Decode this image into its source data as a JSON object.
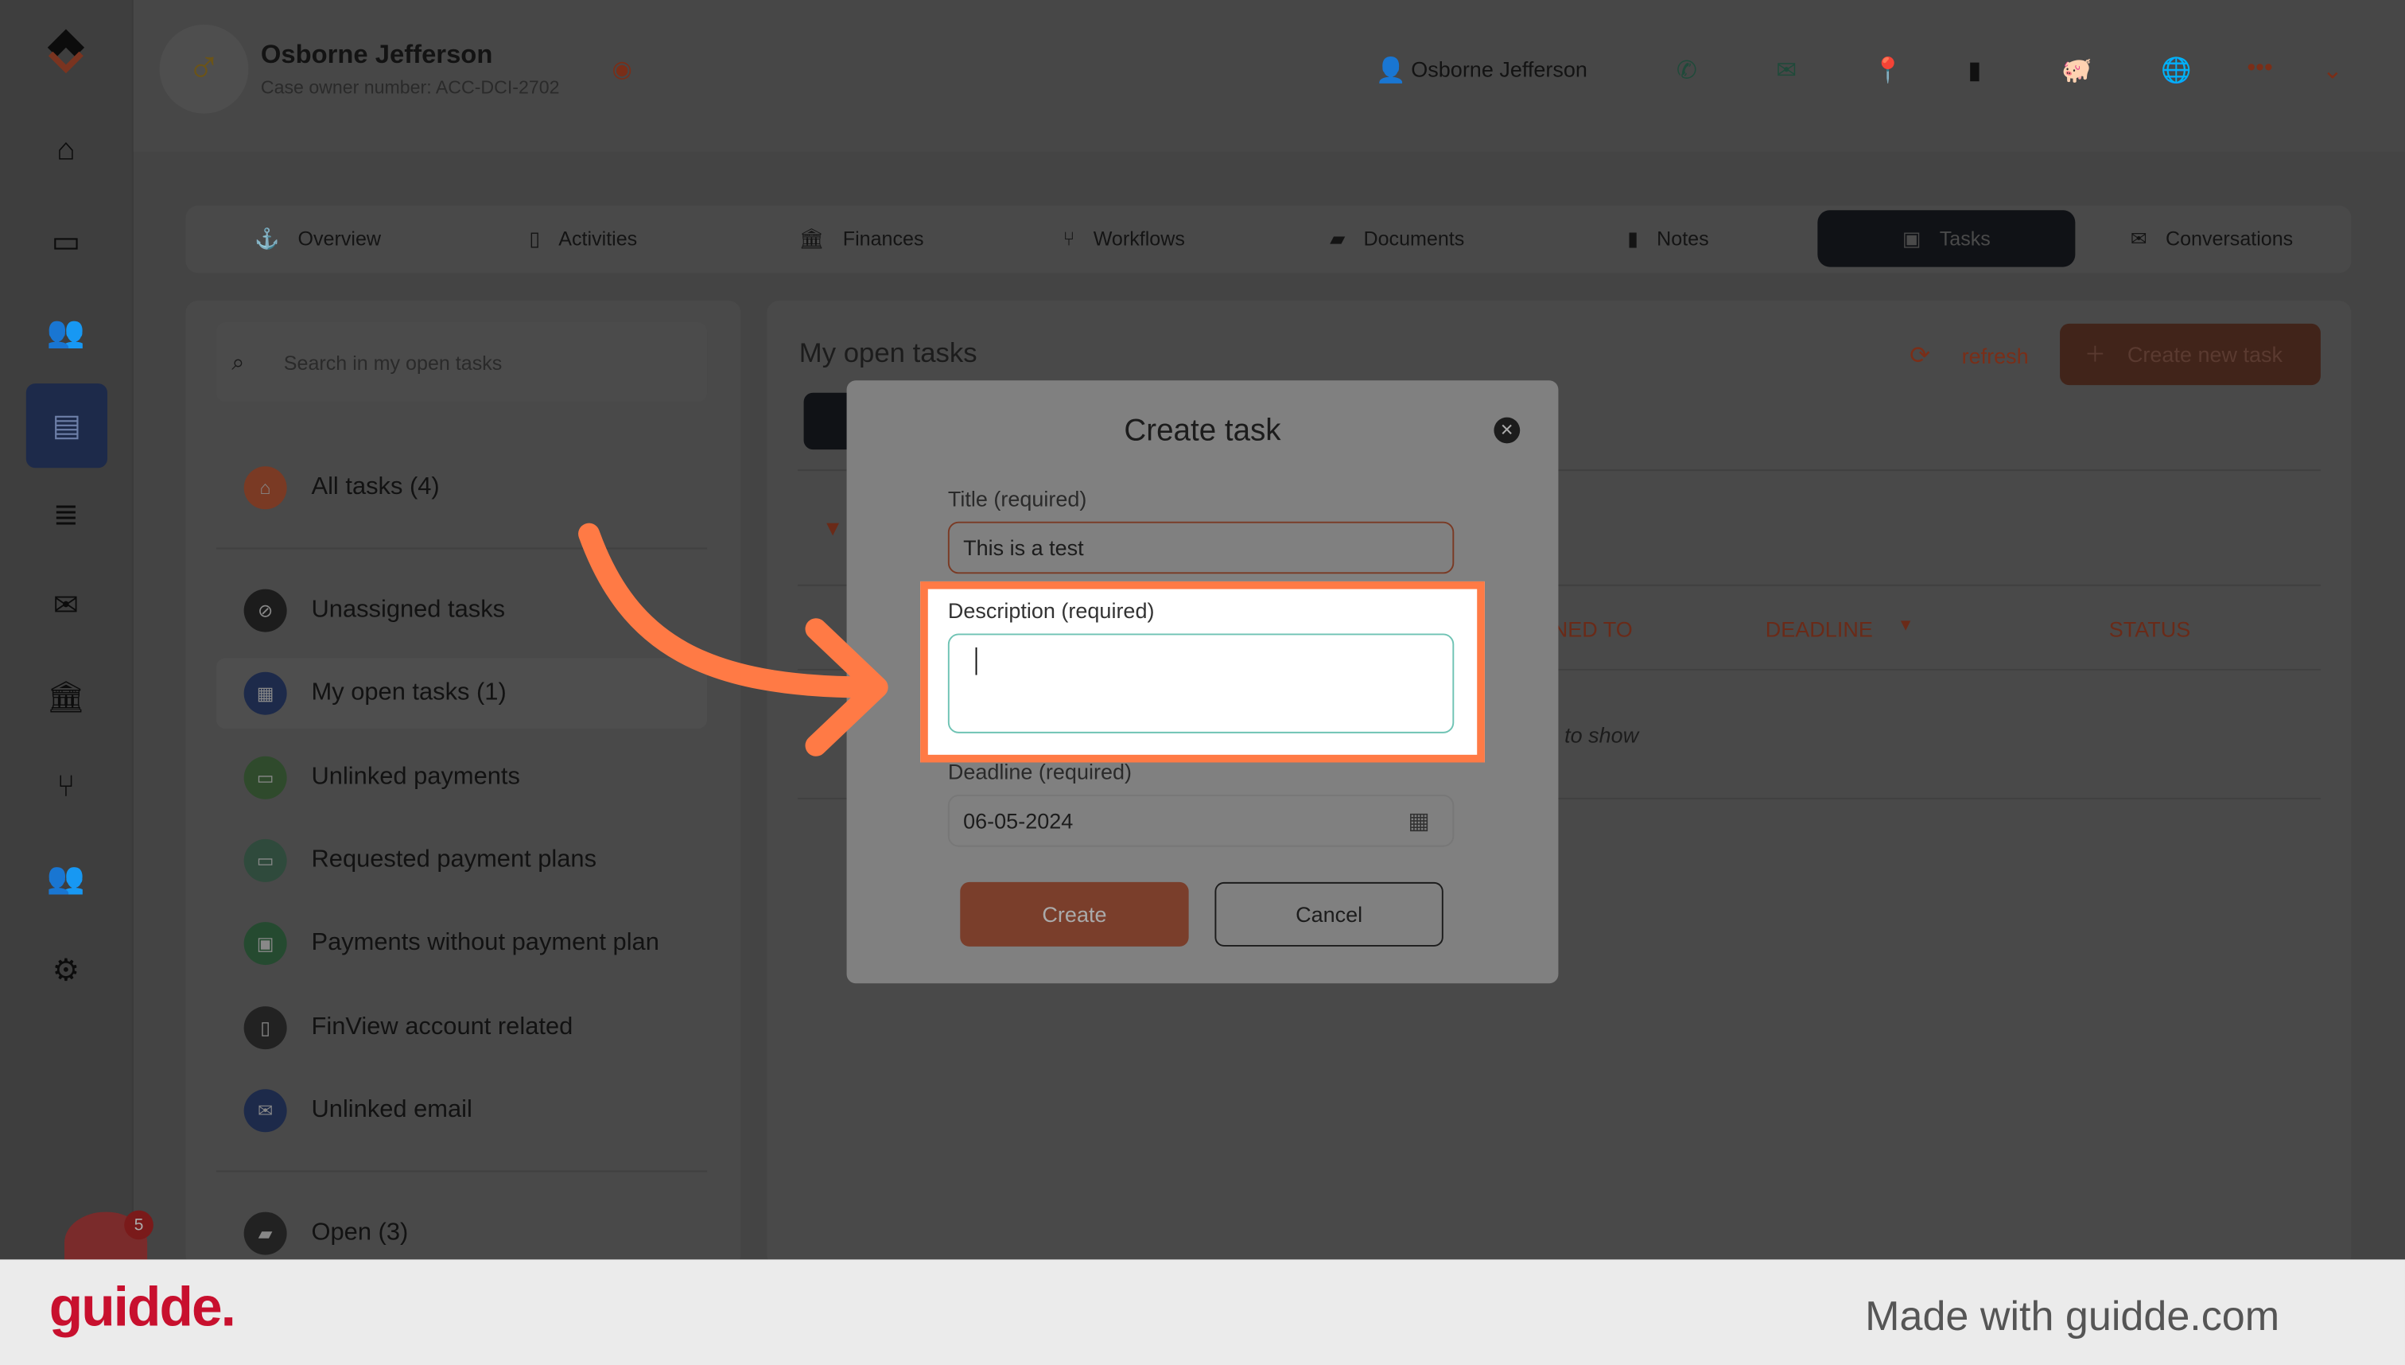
{
  "header": {
    "name": "Osborne Jefferson",
    "case_owner": "Case owner number: ACC-DCI-2702",
    "contact_name": "Osborne Jefferson"
  },
  "tabs": [
    {
      "label": "Overview"
    },
    {
      "label": "Activities"
    },
    {
      "label": "Finances"
    },
    {
      "label": "Workflows"
    },
    {
      "label": "Documents"
    },
    {
      "label": "Notes"
    },
    {
      "label": "Tasks",
      "active": true
    },
    {
      "label": "Conversations"
    }
  ],
  "left": {
    "search_placeholder": "Search in my open tasks",
    "items": [
      {
        "label": "All tasks (4)",
        "color": "#7a3a24"
      },
      {
        "label": "Unassigned tasks",
        "color": "#1c1c1c"
      },
      {
        "label": "My open tasks (1)",
        "color": "#1d2a4a"
      },
      {
        "label": "Unlinked payments",
        "color": "#2f4a2c"
      },
      {
        "label": "Requested payment plans",
        "color": "#2f4a3c"
      },
      {
        "label": "Payments without payment plan",
        "color": "#254a30"
      },
      {
        "label": "FinView account related",
        "color": "#222"
      },
      {
        "label": "Unlinked email",
        "color": "#1d2a4a"
      },
      {
        "label": "Open (3)",
        "color": "#222"
      }
    ]
  },
  "main": {
    "title": "My open tasks",
    "refresh": "refresh",
    "create_new": "Create new task",
    "col_assigned": "NED TO",
    "col_deadline": "DEADLINE",
    "col_status": "STATUS",
    "empty": "to show"
  },
  "modal": {
    "title": "Create task",
    "title_label": "Title (required)",
    "title_value": "This is a test",
    "desc_label": "Description (required)",
    "desc_value": "",
    "deadline_label": "Deadline (required)",
    "deadline_value": "06-05-2024",
    "create": "Create",
    "cancel": "Cancel"
  },
  "notification_count": "5",
  "footer": {
    "brand": "guidde.",
    "made_with": "Made with guidde.com"
  },
  "colors": {
    "accent": "#ff7a45",
    "brand_red": "#c8102e"
  }
}
